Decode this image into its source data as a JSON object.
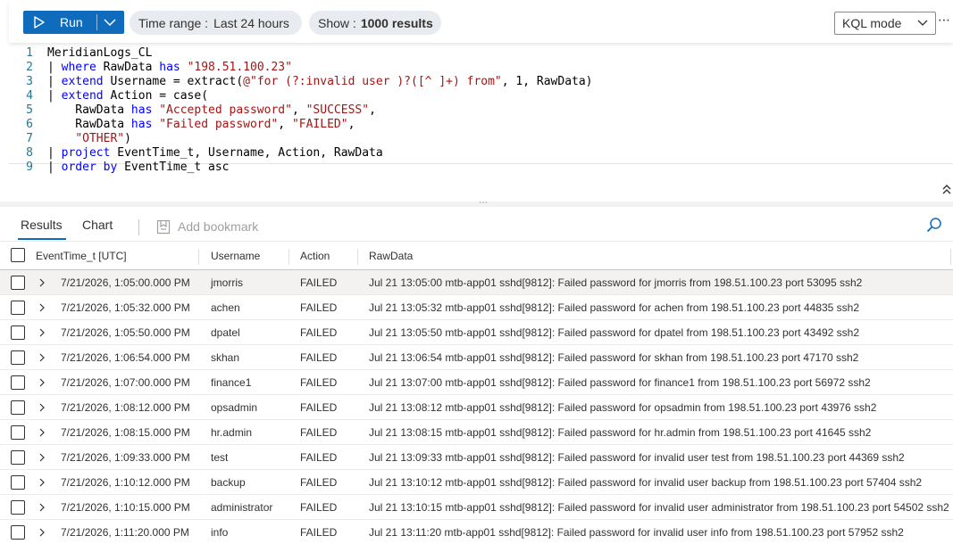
{
  "toolbar": {
    "run_label": "Run",
    "time_range": {
      "key": "Time range :",
      "value": "Last 24 hours"
    },
    "show": {
      "key": "Show :",
      "value": "1000 results"
    },
    "mode": "KQL mode",
    "more": "⋯"
  },
  "editor": {
    "lines": [
      {
        "num": "1",
        "parts": [
          {
            "t": "MeridianLogs_CL",
            "c": ""
          }
        ]
      },
      {
        "num": "2",
        "parts": [
          {
            "t": "| ",
            "c": "pipe"
          },
          {
            "t": "where",
            "c": "kw"
          },
          {
            "t": " RawData ",
            "c": ""
          },
          {
            "t": "has",
            "c": "kw"
          },
          {
            "t": " ",
            "c": ""
          },
          {
            "t": "\"198.51.100.23\"",
            "c": "str"
          }
        ]
      },
      {
        "num": "3",
        "parts": [
          {
            "t": "| ",
            "c": "pipe"
          },
          {
            "t": "extend",
            "c": "kw"
          },
          {
            "t": " Username = extract(",
            "c": ""
          },
          {
            "t": "@\"for (?:invalid user )?([^ ]+) from\"",
            "c": "str"
          },
          {
            "t": ", 1, RawData)",
            "c": ""
          }
        ]
      },
      {
        "num": "4",
        "parts": [
          {
            "t": "| ",
            "c": "pipe"
          },
          {
            "t": "extend",
            "c": "kw"
          },
          {
            "t": " Action = case(",
            "c": ""
          }
        ]
      },
      {
        "num": "5",
        "parts": [
          {
            "t": "    RawData ",
            "c": ""
          },
          {
            "t": "has",
            "c": "kw"
          },
          {
            "t": " ",
            "c": ""
          },
          {
            "t": "\"Accepted password\"",
            "c": "str"
          },
          {
            "t": ", ",
            "c": ""
          },
          {
            "t": "\"SUCCESS\"",
            "c": "str"
          },
          {
            "t": ",",
            "c": ""
          }
        ]
      },
      {
        "num": "6",
        "parts": [
          {
            "t": "    RawData ",
            "c": ""
          },
          {
            "t": "has",
            "c": "kw"
          },
          {
            "t": " ",
            "c": ""
          },
          {
            "t": "\"Failed password\"",
            "c": "str"
          },
          {
            "t": ", ",
            "c": ""
          },
          {
            "t": "\"FAILED\"",
            "c": "str"
          },
          {
            "t": ",",
            "c": ""
          }
        ]
      },
      {
        "num": "7",
        "parts": [
          {
            "t": "    ",
            "c": ""
          },
          {
            "t": "\"OTHER\"",
            "c": "str"
          },
          {
            "t": ")",
            "c": ""
          }
        ]
      },
      {
        "num": "8",
        "parts": [
          {
            "t": "| ",
            "c": "pipe"
          },
          {
            "t": "project",
            "c": "kw"
          },
          {
            "t": " EventTime_t, Username, Action, RawData",
            "c": ""
          }
        ]
      },
      {
        "num": "9",
        "parts": [
          {
            "t": "| ",
            "c": "pipe"
          },
          {
            "t": "order",
            "c": "kw"
          },
          {
            "t": " ",
            "c": ""
          },
          {
            "t": "by",
            "c": "kw"
          },
          {
            "t": " EventTime_t asc",
            "c": ""
          }
        ]
      }
    ]
  },
  "results": {
    "tabs": {
      "results": "Results",
      "chart": "Chart"
    },
    "bookmark_label": "Add bookmark",
    "columns": {
      "time": "EventTime_t [UTC]",
      "user": "Username",
      "action": "Action",
      "raw": "RawData"
    },
    "rows": [
      {
        "time": "7/21/2026, 1:05:00.000 PM",
        "user": "jmorris",
        "action": "FAILED",
        "raw": "Jul 21 13:05:00 mtb-app01 sshd[9812]: Failed password for jmorris from 198.51.100.23 port 53095 ssh2"
      },
      {
        "time": "7/21/2026, 1:05:32.000 PM",
        "user": "achen",
        "action": "FAILED",
        "raw": "Jul 21 13:05:32 mtb-app01 sshd[9812]: Failed password for achen from 198.51.100.23 port 44835 ssh2"
      },
      {
        "time": "7/21/2026, 1:05:50.000 PM",
        "user": "dpatel",
        "action": "FAILED",
        "raw": "Jul 21 13:05:50 mtb-app01 sshd[9812]: Failed password for dpatel from 198.51.100.23 port 43492 ssh2"
      },
      {
        "time": "7/21/2026, 1:06:54.000 PM",
        "user": "skhan",
        "action": "FAILED",
        "raw": "Jul 21 13:06:54 mtb-app01 sshd[9812]: Failed password for skhan from 198.51.100.23 port 47170 ssh2"
      },
      {
        "time": "7/21/2026, 1:07:00.000 PM",
        "user": "finance1",
        "action": "FAILED",
        "raw": "Jul 21 13:07:00 mtb-app01 sshd[9812]: Failed password for finance1 from 198.51.100.23 port 56972 ssh2"
      },
      {
        "time": "7/21/2026, 1:08:12.000 PM",
        "user": "opsadmin",
        "action": "FAILED",
        "raw": "Jul 21 13:08:12 mtb-app01 sshd[9812]: Failed password for opsadmin from 198.51.100.23 port 43976 ssh2"
      },
      {
        "time": "7/21/2026, 1:08:15.000 PM",
        "user": "hr.admin",
        "action": "FAILED",
        "raw": "Jul 21 13:08:15 mtb-app01 sshd[9812]: Failed password for hr.admin from 198.51.100.23 port 41645 ssh2"
      },
      {
        "time": "7/21/2026, 1:09:33.000 PM",
        "user": "test",
        "action": "FAILED",
        "raw": "Jul 21 13:09:33 mtb-app01 sshd[9812]: Failed password for invalid user test from 198.51.100.23 port 44369 ssh2"
      },
      {
        "time": "7/21/2026, 1:10:12.000 PM",
        "user": "backup",
        "action": "FAILED",
        "raw": "Jul 21 13:10:12 mtb-app01 sshd[9812]: Failed password for invalid user backup from 198.51.100.23 port 57404 ssh2"
      },
      {
        "time": "7/21/2026, 1:10:15.000 PM",
        "user": "administrator",
        "action": "FAILED",
        "raw": "Jul 21 13:10:15 mtb-app01 sshd[9812]: Failed password for invalid user administrator from 198.51.100.23 port 54502 ssh2"
      },
      {
        "time": "7/21/2026, 1:11:20.000 PM",
        "user": "info",
        "action": "FAILED",
        "raw": "Jul 21 13:11:20 mtb-app01 sshd[9812]: Failed password for invalid user info from 198.51.100.23 port 57952 ssh2"
      }
    ]
  },
  "icons": {
    "run": "play-icon",
    "run_menu": "chevron-down-icon",
    "mode_menu": "chevron-down-icon",
    "collapse": "double-chevron-up-icon",
    "bookmark": "bookmark-icon",
    "search": "search-icon",
    "expand": "chevron-right-icon"
  },
  "colors": {
    "accent": "#0f6cbd",
    "keyword": "#0000ff",
    "string": "#a31515",
    "line_number": "#237893",
    "pill_bg": "#e8ebf0"
  }
}
